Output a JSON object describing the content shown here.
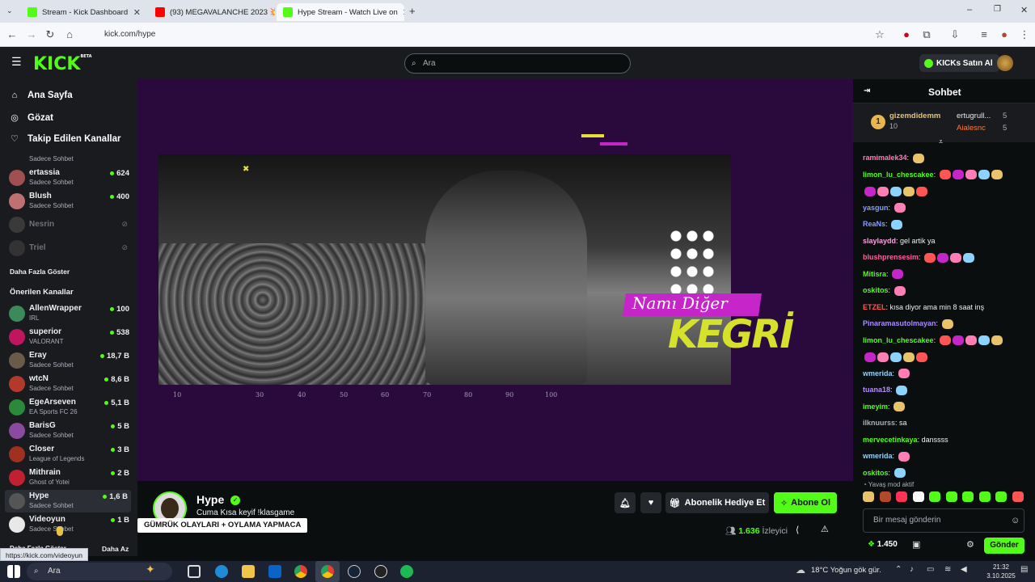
{
  "browser": {
    "tabs": [
      {
        "label": "Stream - Kick Dashboard",
        "color": "#53fc18"
      },
      {
        "label": "(93) MEGAVALANCHE 2023 💥",
        "color": "#ff0000"
      },
      {
        "label": "Hype Stream - Watch Live on",
        "color": "#53fc18"
      }
    ],
    "url": "kick.com/hype",
    "status_url": "https://kick.com/videoyun"
  },
  "header": {
    "logo": "KICK",
    "logo_badge": "BETA",
    "search_placeholder": "Ara",
    "kicks_button": "KICKs Satın Al"
  },
  "sidebar": {
    "nav": [
      {
        "label": "Ana Sayfa",
        "icon": "home-icon"
      },
      {
        "label": "Gözat",
        "icon": "compass-icon"
      },
      {
        "label": "Takip Edilen Kanallar",
        "icon": "heart-icon"
      }
    ],
    "followed_partial": "Sadece Sohbet",
    "followed": [
      {
        "name": "ertassia",
        "category": "Sadece Sohbet",
        "viewers": "624"
      },
      {
        "name": "Blush",
        "category": "Sadece Sohbet",
        "viewers": "400"
      },
      {
        "name": "Nesrin",
        "category": "",
        "viewers": ""
      },
      {
        "name": "Triel",
        "category": "",
        "viewers": ""
      }
    ],
    "show_more": "Daha Fazla Göster",
    "recommended_title": "Önerilen Kanallar",
    "recommended": [
      {
        "name": "AllenWrapper",
        "category": "IRL",
        "viewers": "100"
      },
      {
        "name": "superior",
        "category": "VALORANT",
        "viewers": "538"
      },
      {
        "name": "Eray",
        "category": "Sadece Sohbet",
        "viewers": "18,7 B"
      },
      {
        "name": "wtcN",
        "category": "Sadece Sohbet",
        "viewers": "8,6 B"
      },
      {
        "name": "EgeArseven",
        "category": "EA Sports FC 26",
        "viewers": "5,1 B"
      },
      {
        "name": "BarisG",
        "category": "Sadece Sohbet",
        "viewers": "5 B"
      },
      {
        "name": "Closer",
        "category": "League of Legends",
        "viewers": "3 B"
      },
      {
        "name": "Mithrain",
        "category": "Ghost of Yotei",
        "viewers": "2 B"
      },
      {
        "name": "Hype",
        "category": "Sadece Sohbet",
        "viewers": "1,6 B"
      },
      {
        "name": "Videoyun",
        "category": "Sadece Sohbet",
        "viewers": "1 B"
      }
    ],
    "show_more_2": "Daha Fazla Göster",
    "show_less": "Daha Az"
  },
  "player": {
    "overlay_tag": "Namı Diğer",
    "overlay_name": "KEGRİ",
    "ticks": [
      "10",
      "30",
      "40",
      "50",
      "60",
      "70",
      "80",
      "90",
      "100"
    ]
  },
  "stream": {
    "channel": "Hype",
    "title": "Cuma Kısa keyif !klasgame",
    "tooltip": "GÜMRÜK OLAYLARI + OYLAMA YAPMACA",
    "gift_button": "Abonelik Hediye Et",
    "subscribe_button": "Abone Ol",
    "viewers": "1.636",
    "viewers_label": "İzleyici"
  },
  "chat": {
    "title": "Sohbet",
    "pinned": {
      "rank": "1",
      "user": "gizemdidemm",
      "count": "10",
      "entries": [
        {
          "user": "ertugrull...",
          "value": "5"
        },
        {
          "user": "Aialesnc",
          "value": "5"
        }
      ]
    },
    "messages": [
      {
        "user": "ramimalek34",
        "text": "",
        "color": "#ff7eb6",
        "emotes": 1
      },
      {
        "user": "limon_lu_chescakee",
        "text": "",
        "color": "#53fc18",
        "emotes": 5
      },
      {
        "user": "",
        "text": "",
        "color": "#ff5555",
        "emotes": 5
      },
      {
        "user": "yasgun",
        "text": "",
        "color": "#8a9bff",
        "emotes": 1
      },
      {
        "user": "ReaNs",
        "text": "",
        "color": "#8a9bff",
        "emotes": 1
      },
      {
        "user": "slaylaydd",
        "text": "gel artik ya",
        "color": "#ff9fe0",
        "emotes": 0
      },
      {
        "user": "blushprensesim",
        "text": "",
        "color": "#ff5fa0",
        "emotes": 4
      },
      {
        "user": "Mitisra",
        "text": "",
        "color": "#53fc18",
        "emotes": 1
      },
      {
        "user": "oskitos",
        "text": "",
        "color": "#53fc18",
        "emotes": 1
      },
      {
        "user": "ETZEL",
        "text": "kısa diyor ama min 8 saat inş",
        "color": "#ff5555",
        "emotes": 0
      },
      {
        "user": "Pinaramasutolmayan",
        "text": "",
        "color": "#a98bff",
        "emotes": 1
      },
      {
        "user": "limon_lu_chescakee",
        "text": "",
        "color": "#53fc18",
        "emotes": 5
      },
      {
        "user": "",
        "text": "",
        "color": "#ff5555",
        "emotes": 5
      },
      {
        "user": "wmerida",
        "text": "",
        "color": "#8ad4ff",
        "emotes": 1
      },
      {
        "user": "tuana18",
        "text": "",
        "color": "#b58cff",
        "emotes": 1
      },
      {
        "user": "imeyim",
        "text": "",
        "color": "#53fc18",
        "emotes": 1
      },
      {
        "user": "ilknuurss",
        "text": "sa",
        "color": "#adadb8",
        "emotes": 0
      },
      {
        "user": "mervecetinkaya",
        "text": "danssss",
        "color": "#53fc18",
        "emotes": 0
      },
      {
        "user": "wmerida",
        "text": "",
        "color": "#8ad4ff",
        "emotes": 1
      },
      {
        "user": "oskitos",
        "text": "",
        "color": "#53fc18",
        "emotes": 1
      }
    ],
    "slow_mode": "Yavaş mod aktif",
    "input_placeholder": "Bir mesaj gönderin",
    "points": "1.450",
    "send_button": "Gönder"
  },
  "taskbar": {
    "search": "Ara",
    "weather": "18°C  Yoğun gök gür.",
    "time": "21:32",
    "date": "3.10.2025"
  }
}
